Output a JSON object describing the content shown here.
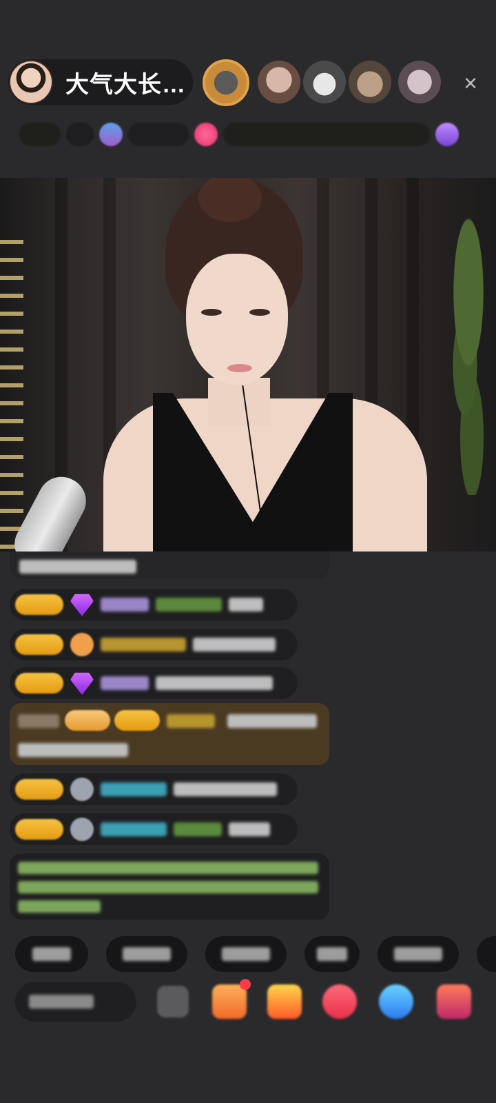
{
  "header": {
    "host_name": "大气大长…",
    "close_symbol": "×"
  },
  "icons": {
    "host_avatar": "avatar",
    "close": "close-icon"
  }
}
